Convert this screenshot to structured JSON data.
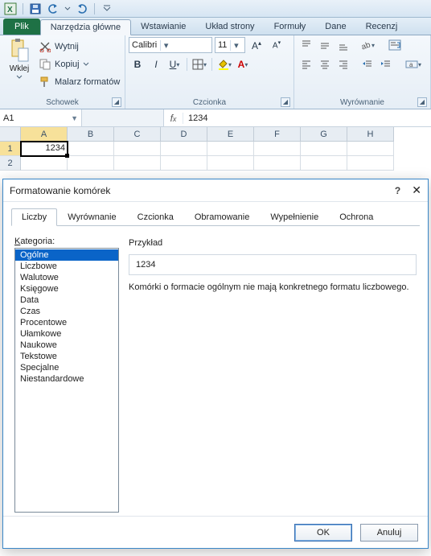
{
  "qat": {},
  "tabs": {
    "file": "Plik",
    "items": [
      "Narzędzia główne",
      "Wstawianie",
      "Układ strony",
      "Formuły",
      "Dane",
      "Recenzj"
    ],
    "active_index": 0
  },
  "ribbon": {
    "clipboard": {
      "paste_label": "Wklej",
      "cut": "Wytnij",
      "copy": "Kopiuj",
      "painter": "Malarz formatów",
      "group_title": "Schowek"
    },
    "font": {
      "name": "Calibri",
      "size": "11",
      "group_title": "Czcionka"
    },
    "align": {
      "group_title": "Wyrównanie"
    }
  },
  "namebox": "A1",
  "formula": "1234",
  "columns": [
    "A",
    "B",
    "C",
    "D",
    "E",
    "F",
    "G",
    "H"
  ],
  "rows": [
    "1",
    "2"
  ],
  "cell_a1": "1234",
  "dialog": {
    "title": "Formatowanie komórek",
    "tabs": [
      "Liczby",
      "Wyrównanie",
      "Czcionka",
      "Obramowanie",
      "Wypełnienie",
      "Ochrona"
    ],
    "active_tab": 0,
    "category_label_pre": "K",
    "category_label_rest": "ategoria:",
    "categories": [
      "Ogólne",
      "Liczbowe",
      "Walutowe",
      "Księgowe",
      "Data",
      "Czas",
      "Procentowe",
      "Ułamkowe",
      "Naukowe",
      "Tekstowe",
      "Specjalne",
      "Niestandardowe"
    ],
    "selected_category": 0,
    "sample_label": "Przykład",
    "sample_value": "1234",
    "description": "Komórki o formacie ogólnym nie mają konkretnego formatu liczbowego.",
    "ok": "OK",
    "cancel": "Anuluj"
  }
}
